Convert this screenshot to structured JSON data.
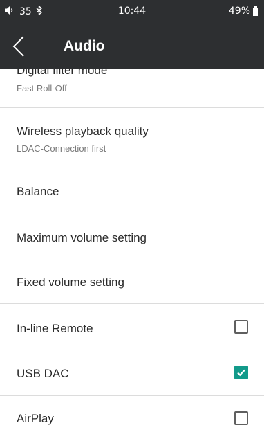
{
  "status": {
    "volume_level": "35",
    "time": "10:44",
    "battery": "49%"
  },
  "app_bar": {
    "title": "Audio"
  },
  "items": [
    {
      "title": "Digital filter mode",
      "subtitle": "Fast Roll-Off"
    },
    {
      "title": "Wireless playback quality",
      "subtitle": "LDAC-Connection first"
    },
    {
      "title": "Balance"
    },
    {
      "title": "Maximum volume setting"
    },
    {
      "title": "Fixed volume setting"
    },
    {
      "title": "In-line Remote",
      "checked": false
    },
    {
      "title": "USB DAC",
      "checked": true
    },
    {
      "title": "AirPlay",
      "checked": false
    }
  ],
  "colors": {
    "bar": "#2d2f31",
    "accent": "#129a8a"
  },
  "icons": [
    "volume-icon",
    "bluetooth-icon",
    "battery-icon",
    "back-chevron-icon",
    "checkbox-icon"
  ]
}
